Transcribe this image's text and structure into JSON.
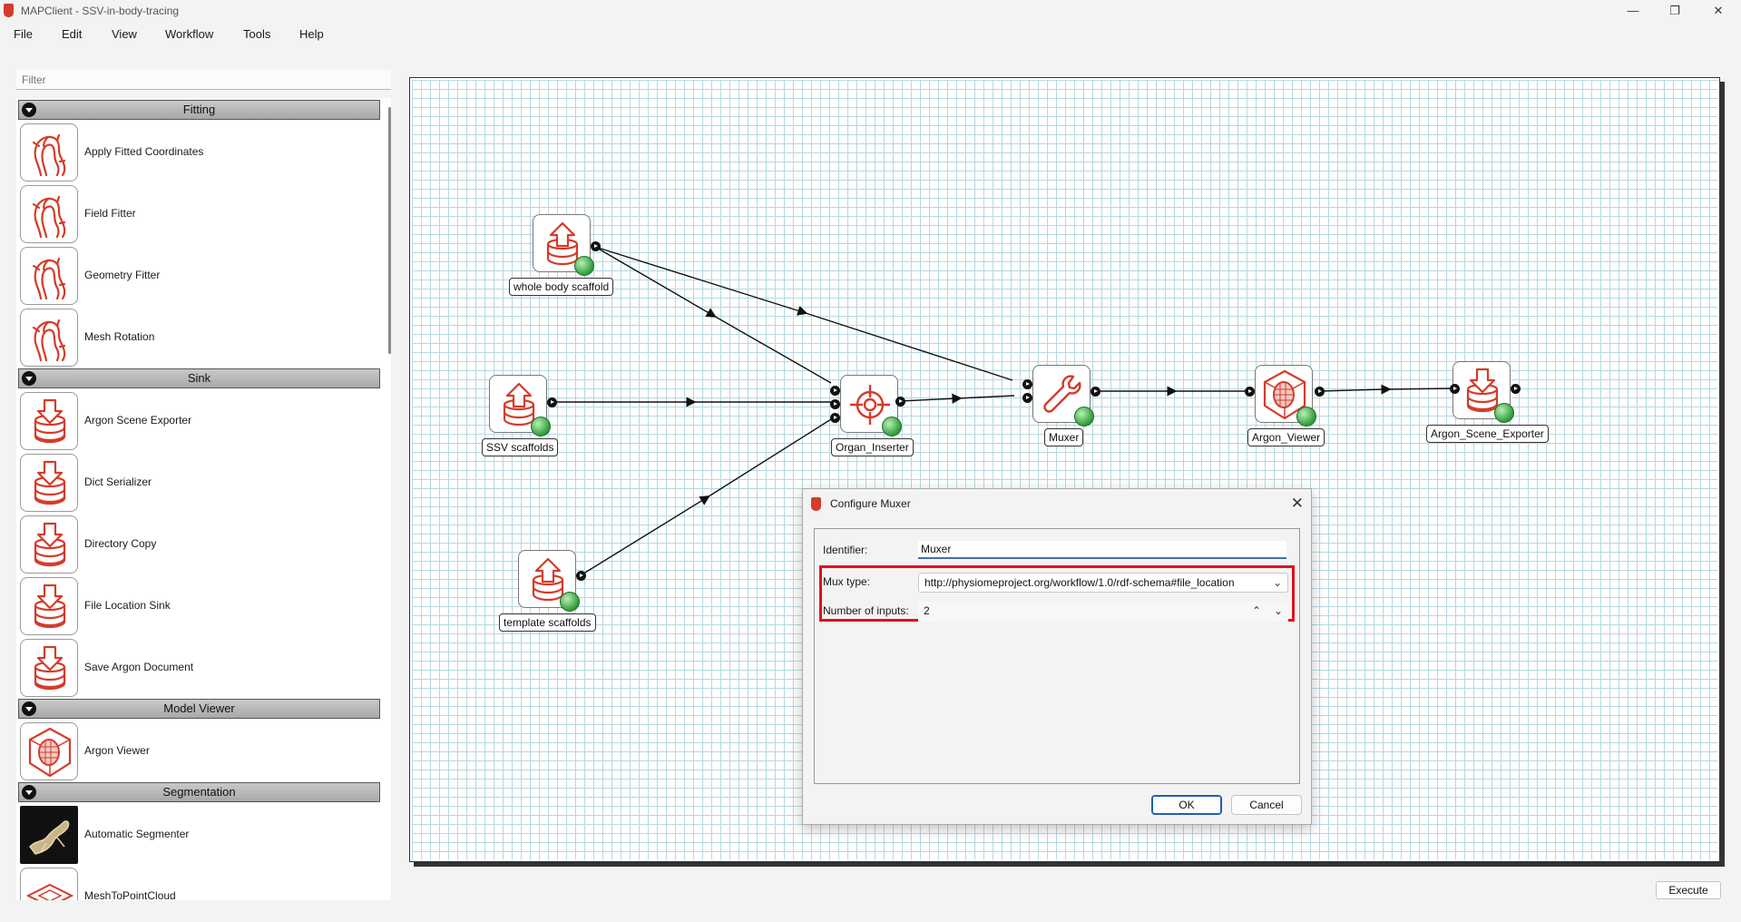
{
  "window": {
    "title": "MAPClient - SSV-in-body-tracing",
    "minimize": "—",
    "maximize": "❐",
    "close": "✕"
  },
  "menu": [
    "File",
    "Edit",
    "View",
    "Workflow",
    "Tools",
    "Help"
  ],
  "filter": {
    "placeholder": "Filter"
  },
  "step_list": {
    "categories": [
      {
        "name": "Fitting",
        "items": [
          "Apply Fitted Coordinates",
          "Field Fitter",
          "Geometry Fitter",
          "Mesh Rotation"
        ]
      },
      {
        "name": "Sink",
        "items": [
          "Argon Scene Exporter",
          "Dict Serializer",
          "Directory Copy",
          "File Location Sink",
          "Save Argon Document"
        ]
      },
      {
        "name": "Model Viewer",
        "items": [
          "Argon Viewer"
        ]
      },
      {
        "name": "Segmentation",
        "items": [
          "Automatic Segmenter",
          "MeshToPointCloud"
        ]
      }
    ]
  },
  "workflow": {
    "nodes": [
      {
        "id": "whole",
        "label": "whole body scaffold",
        "icon": "upload-database-icon"
      },
      {
        "id": "ssv",
        "label": "SSV scaffolds",
        "icon": "upload-database-icon"
      },
      {
        "id": "template",
        "label": "template scaffolds",
        "icon": "upload-database-icon"
      },
      {
        "id": "organ",
        "label": "Organ_Inserter",
        "icon": "target-icon"
      },
      {
        "id": "muxer",
        "label": "Muxer",
        "icon": "wrench-icon"
      },
      {
        "id": "viewer",
        "label": "Argon_Viewer",
        "icon": "argon-viewer-icon"
      },
      {
        "id": "exporter",
        "label": "Argon_Scene_Exporter",
        "icon": "download-database-icon"
      }
    ]
  },
  "dialog": {
    "title": "Configure Muxer",
    "close": "✕",
    "identifier_label": "Identifier:",
    "identifier_value": "Muxer",
    "mux_type_label": "Mux type:",
    "mux_type_value": "http://physiomeproject.org/workflow/1.0/rdf-schema#file_location",
    "inputs_label": "Number of inputs:",
    "inputs_value": "2",
    "ok": "OK",
    "cancel": "Cancel"
  },
  "execute": "Execute",
  "colors": {
    "icon_red": "#d43b2a",
    "grid": "#b5d8e3",
    "highlight": "#e0101a",
    "status_green": "#2e9b3b"
  }
}
